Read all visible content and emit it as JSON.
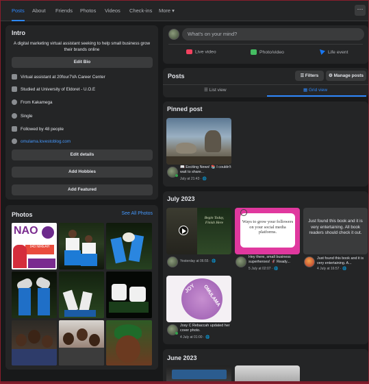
{
  "tabs": [
    "Posts",
    "About",
    "Friends",
    "Photos",
    "Videos",
    "Check-ins",
    "More ▾"
  ],
  "more_icon": "···",
  "intro": {
    "title": "Intro",
    "bio": "A digital marketing virtual assistant seeking to help small business grow their brands online",
    "edit_bio": "Edit Bio",
    "work": "Virtual assistant at 20four7VA Career Center",
    "study": "Studied at University of Eldoret - U.O.E",
    "from": "From Kakamega",
    "relationship": "Single",
    "followers": "Followed by 48 people",
    "website": "omulama.lovestoblog.com",
    "edit_details": "Edit details",
    "add_hobbies": "Add Hobbies",
    "add_featured": "Add Featured"
  },
  "photos": {
    "title": "Photos",
    "see_all": "See All Photos",
    "first_photo_text": [
      "NAO",
      "043 NIREAH"
    ]
  },
  "composer": {
    "placeholder": "What's on your mind?",
    "live_video": "Live video",
    "photo_video": "Photo/video",
    "life_event": "Life event",
    "colors": {
      "live": "#f3425f",
      "photo": "#45bd62",
      "event": "#1877f2"
    }
  },
  "posts_header": {
    "title": "Posts",
    "filters": "Filters",
    "manage": "Manage posts",
    "list_view": "List view",
    "grid_view": "Grid view"
  },
  "pinned": {
    "title": "Pinned post",
    "caption": "📖 Exciting News! 📚 I couldn't wait to share...",
    "meta": "July at 21:43 · 🌐"
  },
  "july": {
    "title": "July 2023",
    "post1_meta": "Yesterday at 06:55 · 🌐",
    "post1_text": [
      "Begin",
      "Today,",
      "Finish",
      "Here"
    ],
    "post2_card_text": "Ways to grow your followers on your social media platforms.",
    "post2_caption": "Hey there, small business superheroes! 🦸 Ready...",
    "post2_meta": "5 July at 02:07 · 🌐",
    "post3_card_text": "Just found this book and it is very entertaining. All book readers should check it out.",
    "post3_caption": "Just found this book and it is very entertaining. A...",
    "post3_meta": "4 July at 16:57 · 🌐",
    "post4_caption": "Josy C Rebaccah updated her cover photo.",
    "post4_meta": "4 July at 01:00 · 🌐",
    "post4_art": [
      "JOY",
      "OMULAMA"
    ]
  },
  "june": {
    "title": "June 2023"
  }
}
